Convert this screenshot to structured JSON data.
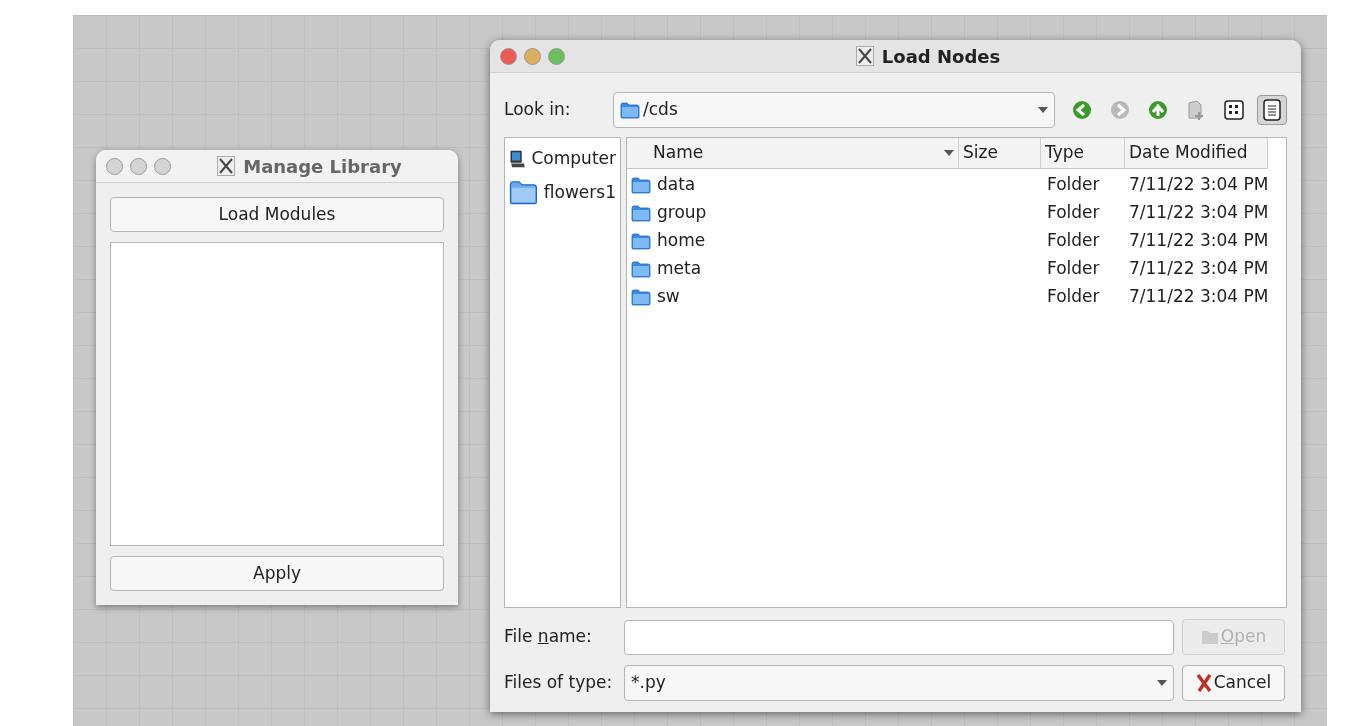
{
  "manage_library": {
    "title": "Manage Library",
    "active": false,
    "load_button": "Load Modules",
    "apply_button": "Apply"
  },
  "load_nodes": {
    "title": "Load Nodes",
    "active": true,
    "look_in": {
      "label": "Look in:",
      "value": "/cds"
    },
    "toolbar": [
      {
        "kind": "back",
        "disabled": false,
        "selected": false
      },
      {
        "kind": "forward",
        "disabled": true,
        "selected": false
      },
      {
        "kind": "up",
        "disabled": false,
        "selected": false
      },
      {
        "kind": "new-folder",
        "disabled": true,
        "selected": false
      },
      {
        "kind": "icon-view",
        "disabled": false,
        "selected": false
      },
      {
        "kind": "detail-view",
        "disabled": false,
        "selected": true
      }
    ],
    "places": [
      {
        "kind": "computer",
        "label": "Computer"
      },
      {
        "kind": "folder",
        "label": "flowers1"
      }
    ],
    "columns": [
      {
        "label": "Name",
        "sorted": true
      },
      {
        "label": "Size",
        "sorted": false
      },
      {
        "label": "Type",
        "sorted": false
      },
      {
        "label": "Date Modified",
        "sorted": false
      }
    ],
    "files": [
      {
        "name": "data",
        "type": "Folder",
        "date": "7/11/22 3:04 PM"
      },
      {
        "name": "group",
        "type": "Folder",
        "date": "7/11/22 3:04 PM"
      },
      {
        "name": "home",
        "type": "Folder",
        "date": "7/11/22 3:04 PM"
      },
      {
        "name": "meta",
        "type": "Folder",
        "date": "7/11/22 3:04 PM"
      },
      {
        "name": "sw",
        "type": "Folder",
        "date": "7/11/22 3:04 PM"
      }
    ],
    "file_name": {
      "label": {
        "before": "File ",
        "mnemonic": "n",
        "after": "ame:"
      }
    },
    "file_type": {
      "label": "Files of type:",
      "value": "*.py"
    },
    "open_button": {
      "label": {
        "mnemonic": "O",
        "after": "pen"
      },
      "disabled": true
    },
    "cancel_button": {
      "label": "Cancel"
    }
  }
}
